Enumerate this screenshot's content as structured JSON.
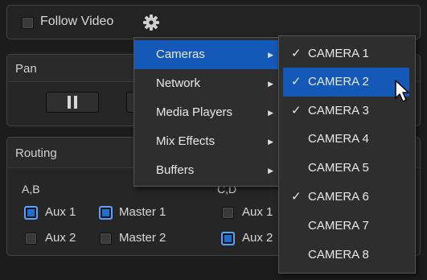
{
  "toolbar": {
    "follow_video_label": "Follow Video",
    "settings_icon": "gear-icon"
  },
  "pan": {
    "label": "Pan"
  },
  "routing": {
    "label": "Routing",
    "group_ab": {
      "label": "A,B",
      "aux1": "Aux 1",
      "aux2": "Aux 2",
      "master1": "Master 1",
      "master2": "Master 2"
    },
    "group_cd": {
      "label": "C,D",
      "aux1": "Aux 1",
      "aux2": "Aux 2"
    }
  },
  "menu": {
    "items": [
      {
        "label": "Cameras",
        "arrow": "▶"
      },
      {
        "label": "Network",
        "arrow": "▶"
      },
      {
        "label": "Media Players",
        "arrow": "▶"
      },
      {
        "label": "Mix Effects",
        "arrow": "▶"
      },
      {
        "label": "Buffers",
        "arrow": "▶"
      }
    ]
  },
  "cameras_submenu": {
    "items": [
      {
        "label": "CAMERA 1",
        "check": "✓"
      },
      {
        "label": "CAMERA 2",
        "check": "✓"
      },
      {
        "label": "CAMERA 3",
        "check": "✓"
      },
      {
        "label": "CAMERA 4",
        "check": ""
      },
      {
        "label": "CAMERA 5",
        "check": ""
      },
      {
        "label": "CAMERA 6",
        "check": "✓"
      },
      {
        "label": "CAMERA 7",
        "check": ""
      },
      {
        "label": "CAMERA 8",
        "check": ""
      }
    ]
  },
  "colors": {
    "highlight": "#1459b8",
    "checkbox_on": "#1f6fd0"
  }
}
